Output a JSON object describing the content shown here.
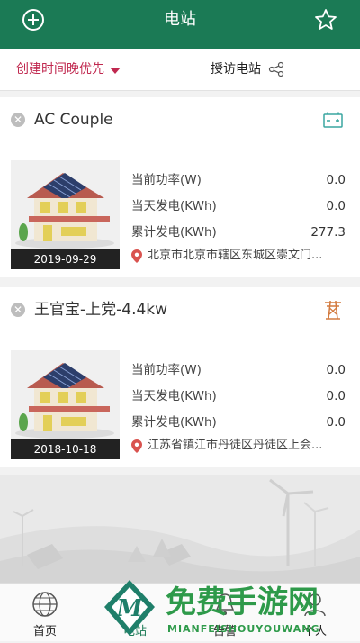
{
  "header": {
    "title": "电站"
  },
  "filter": {
    "sort_label": "创建时间晚优先",
    "share_label": "授访电站"
  },
  "stations": [
    {
      "name": "AC Couple",
      "date": "2019-09-29",
      "rows": [
        {
          "label": "当前功率(W)",
          "value": "0.0"
        },
        {
          "label": "当天发电(KWh)",
          "value": "0.0"
        },
        {
          "label": "累计发电(KWh)",
          "value": "277.3"
        }
      ],
      "address": "北京市北京市辖区东城区崇文门...",
      "type_icon": "battery-icon"
    },
    {
      "name": "王官宝-上党-4.4kw",
      "date": "2018-10-18",
      "rows": [
        {
          "label": "当前功率(W)",
          "value": "0.0"
        },
        {
          "label": "当天发电(KWh)",
          "value": "0.0"
        },
        {
          "label": "累计发电(KWh)",
          "value": "0.0"
        }
      ],
      "address": "江苏省镇江市丹徒区丹徒区上会...",
      "type_icon": "power-tower-icon"
    }
  ],
  "tabs": [
    {
      "label": "首页",
      "icon": "globe-icon"
    },
    {
      "label": "电站",
      "icon": "station-icon"
    },
    {
      "label": "告警",
      "icon": "alert-icon"
    },
    {
      "label": "个人",
      "icon": "person-icon"
    }
  ],
  "watermark": {
    "main": "免费手游网",
    "sub": "MIANFEISHOUYOUWANG"
  },
  "colors": {
    "brand": "#1b7a55",
    "accent": "#c0284f"
  }
}
